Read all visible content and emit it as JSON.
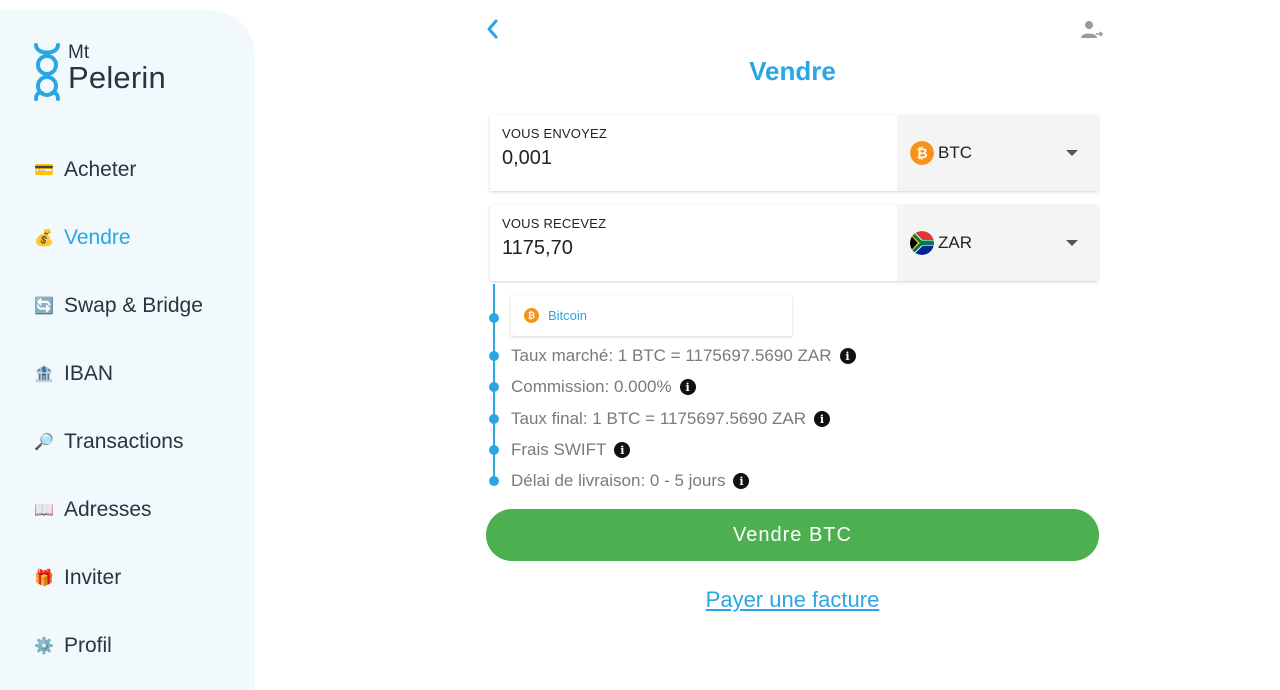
{
  "brand": {
    "line1": "Mt",
    "line2": "Pelerin",
    "color": "#2aa6e4"
  },
  "sidebar": {
    "items": [
      {
        "label": "Acheter",
        "icon": "credit-card-icon",
        "glyph": "💳"
      },
      {
        "label": "Vendre",
        "icon": "money-bag-icon",
        "glyph": "💰",
        "active": true
      },
      {
        "label": "Swap & Bridge",
        "icon": "swap-arrows-icon",
        "glyph": "🔄"
      },
      {
        "label": "IBAN",
        "icon": "bank-icon",
        "glyph": "🏦"
      },
      {
        "label": "Transactions",
        "icon": "magnifier-icon",
        "glyph": "🔎"
      },
      {
        "label": "Adresses",
        "icon": "book-icon",
        "glyph": "📖"
      },
      {
        "label": "Inviter",
        "icon": "gift-icon",
        "glyph": "🎁"
      },
      {
        "label": "Profil",
        "icon": "gear-icon",
        "glyph": "⚙️"
      }
    ]
  },
  "header": {
    "title": "Vendre",
    "back_icon": "chevron-left-icon",
    "account_icon": "user-logout-icon"
  },
  "send": {
    "label": "VOUS ENVOYEZ",
    "value": "0,001",
    "currency": "BTC",
    "currency_icon": "bitcoin-icon"
  },
  "receive": {
    "label": "VOUS RECEVEZ",
    "value": "1175,70",
    "currency": "ZAR",
    "currency_icon": "south-africa-flag-icon"
  },
  "network": {
    "label": "Bitcoin",
    "icon": "bitcoin-icon"
  },
  "details": [
    {
      "text": "Taux marché: 1 BTC = 1175697.5690 ZAR"
    },
    {
      "text": "Commission: 0.000%"
    },
    {
      "text": "Taux final: 1 BTC = 1175697.5690 ZAR"
    },
    {
      "text": "Frais SWIFT"
    },
    {
      "text": "Délai de livraison: 0 - 5 jours"
    }
  ],
  "info_glyph": "i",
  "cta": {
    "label": "Vendre BTC",
    "color": "#4caf50"
  },
  "link": {
    "label": "Payer une facture"
  }
}
